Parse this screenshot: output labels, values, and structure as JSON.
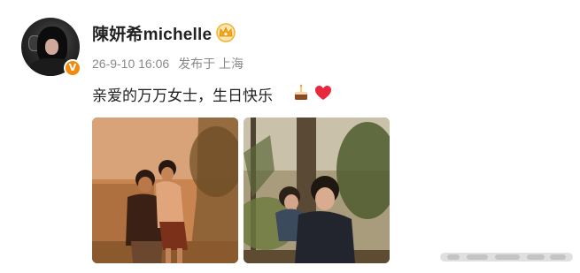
{
  "author": {
    "name": "陳妍希michelle",
    "verified_badge": "V",
    "badge_icon": "crown-icon"
  },
  "meta": {
    "time": "26-9-10 16:06",
    "location": "发布于 上海"
  },
  "post": {
    "text": "亲爱的万万女士，生日快乐",
    "emoji": [
      "cake-icon",
      "heart-icon"
    ]
  },
  "photos": [
    {
      "description_icon": "photo-1"
    },
    {
      "description_icon": "photo-2"
    }
  ],
  "colors": {
    "verified": "#f28a0e",
    "heart": "#e8283c",
    "meta_text": "#8a8a8a"
  }
}
